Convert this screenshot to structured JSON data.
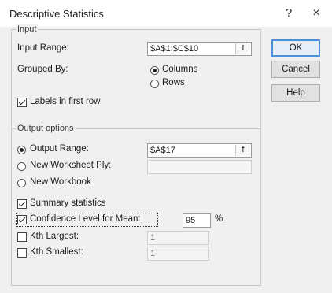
{
  "window": {
    "title": "Descriptive Statistics",
    "help_glyph": "?",
    "close_glyph": "×"
  },
  "input": {
    "legend": "Input",
    "range_label": "Input Range:",
    "range_value": "$A$1:$C$10",
    "grouped_by_label": "Grouped By:",
    "columns_label": "Columns",
    "columns_selected": true,
    "rows_label": "Rows",
    "rows_selected": false,
    "labels_first_row_label": "Labels in first row",
    "labels_first_row_checked": true
  },
  "output": {
    "legend": "Output options",
    "output_range_label": "Output Range:",
    "output_range_value": "$A$17",
    "output_range_selected": true,
    "new_worksheet_label": "New Worksheet Ply:",
    "new_worksheet_value": "",
    "new_workbook_label": "New Workbook",
    "summary_label": "Summary statistics",
    "summary_checked": true,
    "confidence_label": "Confidence Level for Mean:",
    "confidence_checked": true,
    "confidence_value": "95",
    "percent_sign": "%",
    "kth_largest_label": "Kth Largest:",
    "kth_largest_checked": false,
    "kth_largest_value": "1",
    "kth_smallest_label": "Kth Smallest:",
    "kth_smallest_checked": false,
    "kth_smallest_value": "1"
  },
  "buttons": {
    "ok": "OK",
    "cancel": "Cancel",
    "help": "Help"
  },
  "icons": {
    "collapse_glyph": "⭡"
  }
}
